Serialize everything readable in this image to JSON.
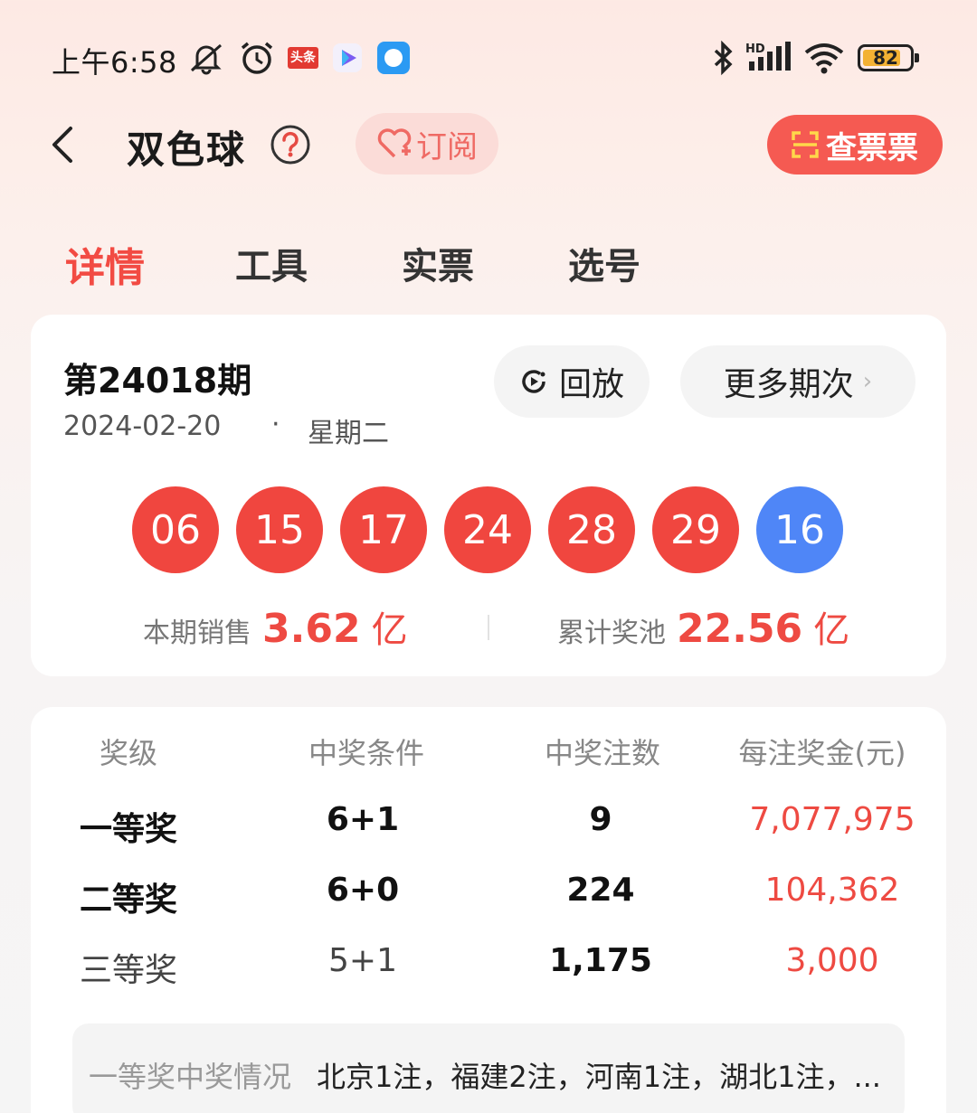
{
  "status_bar": {
    "time": "上午6:58",
    "app_badge": "头条",
    "battery": "82",
    "battery_level": 0.82,
    "network": "HD"
  },
  "header": {
    "title": "双色球",
    "subscribe_label": "订阅",
    "check_ticket_label": "查票票"
  },
  "tabs": [
    {
      "label": "详情",
      "active": true
    },
    {
      "label": "工具",
      "active": false
    },
    {
      "label": "实票",
      "active": false
    },
    {
      "label": "选号",
      "active": false
    }
  ],
  "draw": {
    "issue": "第24018期",
    "date": "2024-02-20",
    "separator": "·",
    "weekday": "星期二",
    "replay_label": "回放",
    "more_label": "更多期次",
    "red_balls": [
      "06",
      "15",
      "17",
      "24",
      "28",
      "29"
    ],
    "blue_balls": [
      "16"
    ],
    "sales_label": "本期销售",
    "sales_value": "3.62",
    "sales_unit": "亿",
    "pool_label": "累计奖池",
    "pool_value": "22.56",
    "pool_unit": "亿"
  },
  "prizes": {
    "headers": [
      "奖级",
      "中奖条件",
      "中奖注数",
      "每注奖金(元)"
    ],
    "rows": [
      {
        "level": "一等奖",
        "condition": "6+1",
        "count": "9",
        "amount": "7,077,975"
      },
      {
        "level": "二等奖",
        "condition": "6+0",
        "count": "224",
        "amount": "104,362"
      },
      {
        "level": "三等奖",
        "condition": "5+1",
        "count": "1,175",
        "amount": "3,000"
      }
    ],
    "first_prize_label": "一等奖中奖情况",
    "first_prize_detail": "北京1注，福建2注，河南1注，湖北1注，..."
  },
  "colors": {
    "accent_red": "#f24b43",
    "ball_red": "#f0463f",
    "ball_blue": "#4f86f7"
  }
}
